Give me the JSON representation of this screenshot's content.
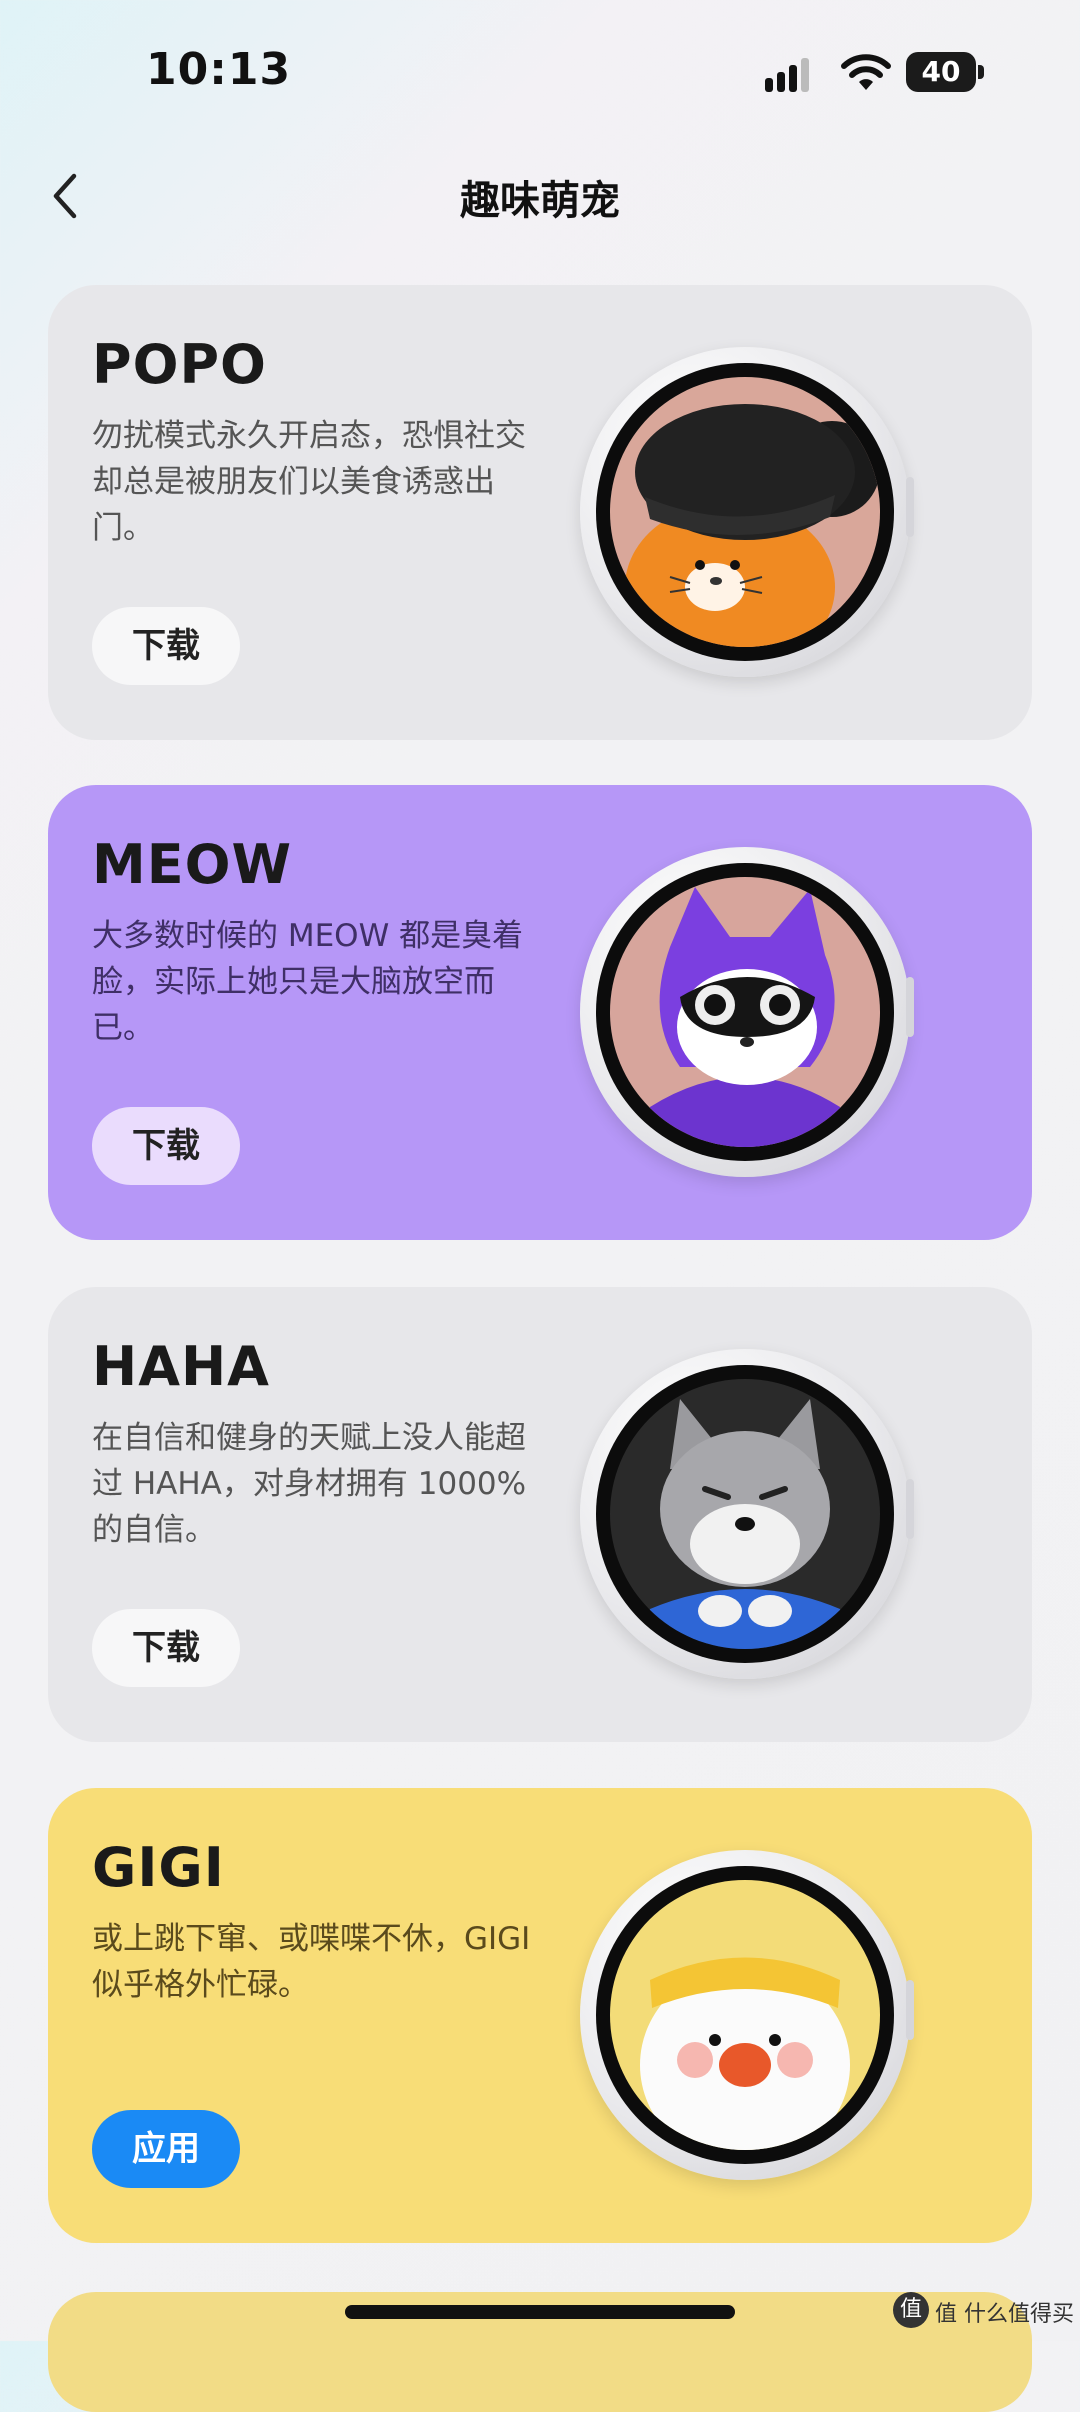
{
  "status_bar": {
    "time": "10:13",
    "battery": "40"
  },
  "header": {
    "title": "趣味萌宠"
  },
  "cards": [
    {
      "name": "POPO",
      "description": "勿扰模式永久开启态，恐惧社交却总是被朋友们以美食诱惑出门。",
      "button": "下载",
      "background": "#e7e7ea"
    },
    {
      "name": "MEOW",
      "description": "大多数时候的 MEOW 都是臭着脸，实际上她只是大脑放空而已。",
      "button": "下载",
      "background": "#b697f7"
    },
    {
      "name": "HAHA",
      "description": "在自信和健身的天赋上没人能超过 HAHA，对身材拥有 1000% 的自信。",
      "button": "下载",
      "background": "#e7e7ea"
    },
    {
      "name": "GIGI",
      "description": "或上跳下窜、或喋喋不休，GIGI 似乎格外忙碌。",
      "button": "应用",
      "background": "#f8dd77"
    }
  ],
  "colors": {
    "apply_button": "#1a8af5",
    "meow_button": "#eadcfd"
  },
  "watermark": {
    "text": "值 什么值得买",
    "icon": "值"
  }
}
